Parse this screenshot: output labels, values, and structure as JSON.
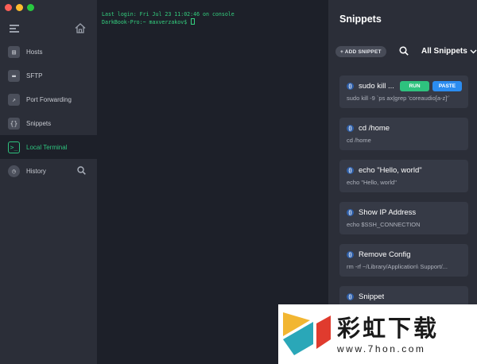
{
  "window": {
    "controls": [
      "close",
      "minimize",
      "zoom"
    ]
  },
  "sidebar": {
    "menu_icon": "hamburger-menu-icon",
    "home_icon": "home-icon",
    "items": [
      {
        "label": "Hosts",
        "icon": "hosts-icon",
        "glyph": "▤"
      },
      {
        "label": "SFTP",
        "icon": "folder-icon",
        "glyph": "▬"
      },
      {
        "label": "Port Forwarding",
        "icon": "port-forwarding-icon",
        "glyph": "↗"
      },
      {
        "label": "Snippets",
        "icon": "braces-icon",
        "glyph": "{}"
      },
      {
        "label": "Local Terminal",
        "icon": "terminal-icon",
        "glyph": ">_",
        "active": true
      },
      {
        "label": "History",
        "icon": "history-icon",
        "glyph": "◷"
      }
    ]
  },
  "terminal": {
    "lines": [
      "Last login: Fri Jul 23 11:02:46 on console",
      "DarkBook-Pro:~ maxverzakov$ "
    ]
  },
  "snippets_panel": {
    "title": "Snippets",
    "add_button": "+ ADD SNIPPET",
    "filter_label": "All Snippets",
    "badge_glyph": "()",
    "run_label": "RUN",
    "paste_label": "PASTE",
    "items": [
      {
        "name": "sudo kill ...",
        "command": "sudo kill -9 `ps ax|grep 'coreaudio[a-z]'`"
      },
      {
        "name": "cd /home",
        "command": "cd /home"
      },
      {
        "name": "echo \"Hello, world\"",
        "command": "echo \"Hello, world\""
      },
      {
        "name": "Show IP Address",
        "command": "echo $SSH_CONNECTION"
      },
      {
        "name": "Remove Config",
        "command": "rm -rf ~/Library/Application\\ Support/..."
      },
      {
        "name": "Snippet",
        "command": ""
      }
    ]
  },
  "watermark": {
    "brand_text": "彩虹下载",
    "url_text": "www.7hon.com",
    "colors": {
      "yellow": "#f2b632",
      "teal": "#2aa7b8",
      "red": "#e03b2e"
    }
  },
  "colors": {
    "accent_green": "#2ec27e",
    "accent_blue": "#2b8cf0",
    "terminal_text": "#34d07f"
  }
}
